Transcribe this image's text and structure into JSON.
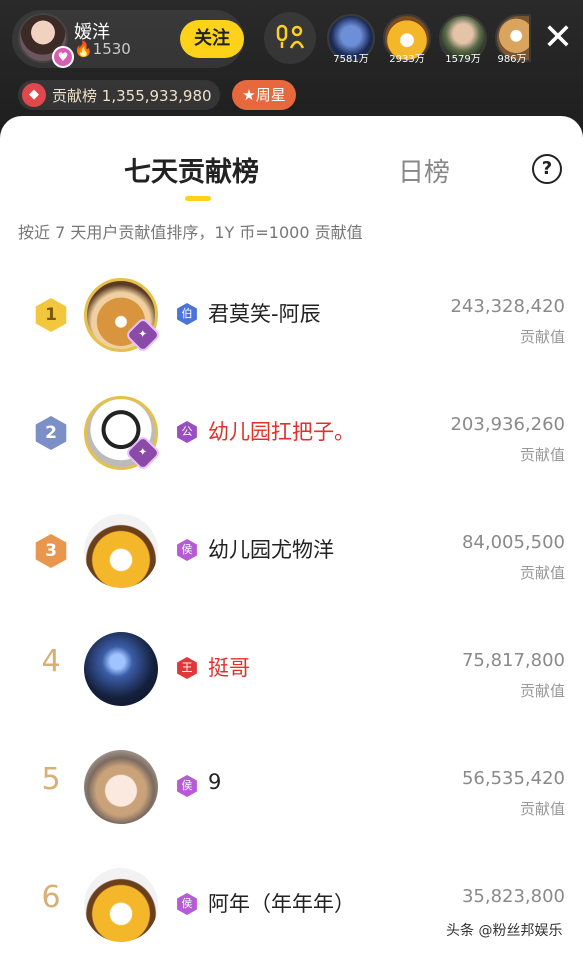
{
  "header": {
    "anchor_name": "嫒洋",
    "anchor_fans": "🔥1530",
    "follow_label": "关注",
    "contribution_label": "贡献榜",
    "contribution_value": "1,355,933,980",
    "weekly_star_label": "周星",
    "viewers": [
      {
        "count": "7581万"
      },
      {
        "count": "2933万"
      },
      {
        "count": "1579万"
      },
      {
        "count": "986万"
      }
    ]
  },
  "panel": {
    "tab_weekly": "七天贡献榜",
    "tab_daily": "日榜",
    "help": "?",
    "subtitle": "按近 7 天用户贡献值排序，1Y 币=1000 贡献值"
  },
  "ranking": [
    {
      "rank": "1",
      "level": "伯",
      "level_color": "#4a74d9",
      "name": "君莫笑-阿辰",
      "name_color": "normal",
      "score": "243,328,420",
      "score_label": "贡献值"
    },
    {
      "rank": "2",
      "level": "公",
      "level_color": "#9b4ec2",
      "name": "幼儿园扛把子。",
      "name_color": "red",
      "score": "203,936,260",
      "score_label": "贡献值"
    },
    {
      "rank": "3",
      "level": "侯",
      "level_color": "#b65ad6",
      "name": "幼儿园尤物洋",
      "name_color": "normal",
      "score": "84,005,500",
      "score_label": "贡献值"
    },
    {
      "rank": "4",
      "level": "王",
      "level_color": "#e0373a",
      "name": "挺哥",
      "name_color": "red",
      "score": "75,817,800",
      "score_label": "贡献值"
    },
    {
      "rank": "5",
      "level": "侯",
      "level_color": "#b65ad6",
      "name": "9",
      "name_color": "normal",
      "score": "56,535,420",
      "score_label": "贡献值"
    },
    {
      "rank": "6",
      "level": "侯",
      "level_color": "#b65ad6",
      "name": "阿年（年年年）",
      "name_color": "normal",
      "score": "35,823,800",
      "score_label": ""
    }
  ],
  "watermark": "头条 @粉丝邦娱乐"
}
